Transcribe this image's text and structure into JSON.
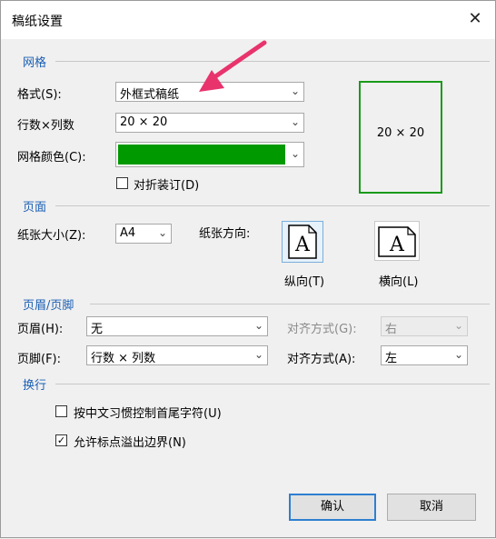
{
  "title": "稿纸设置",
  "close_glyph": "✕",
  "sections": {
    "grid": "网格",
    "page": "页面",
    "header_footer": "页眉/页脚",
    "wrap": "换行"
  },
  "grid": {
    "format_label": "格式(S):",
    "format_value": "外框式稿纸",
    "rowcol_label": "行数×列数",
    "rowcol_value": "20 × 20",
    "color_label": "网格颜色(C):",
    "color_value": "#009900",
    "fold_label": "对折装订(D)",
    "fold_checked": false,
    "preview_text": "20 × 20"
  },
  "page": {
    "size_label": "纸张大小(Z):",
    "size_value": "A4",
    "orient_label": "纸张方向:",
    "portrait_label": "纵向(T)",
    "landscape_label": "横向(L)",
    "orient_glyph": "A",
    "selected": "portrait"
  },
  "header_footer": {
    "header_label": "页眉(H):",
    "header_value": "无",
    "header_align_label": "对齐方式(G):",
    "header_align_value": "右",
    "header_align_disabled": true,
    "footer_label": "页脚(F):",
    "footer_value": "行数 × 列数",
    "footer_align_label": "对齐方式(A):",
    "footer_align_value": "左"
  },
  "wrap": {
    "opt1_label": "按中文习惯控制首尾字符(U)",
    "opt1_checked": false,
    "opt2_label": "允许标点溢出边界(N)",
    "opt2_checked": true
  },
  "buttons": {
    "ok": "确认",
    "cancel": "取消"
  },
  "annotation_color": "#e8336d",
  "dropdown_glyph": "⌄",
  "check_glyph": "✓"
}
